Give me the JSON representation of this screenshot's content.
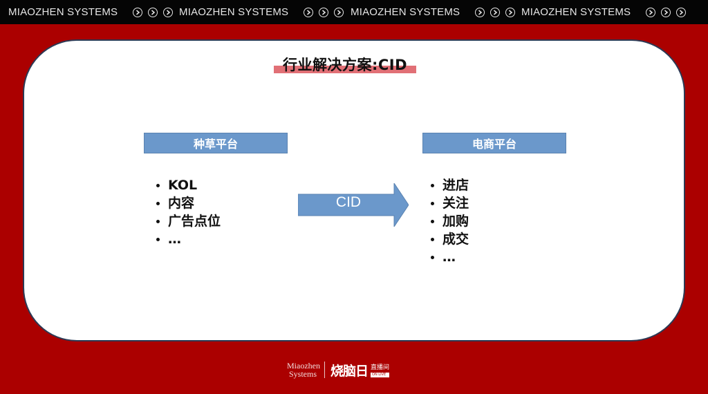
{
  "topbar": {
    "brand_text": "MIAOZHEN SYSTEMS",
    "repeats": 4,
    "icon": "play-circle-icon"
  },
  "slide": {
    "title": "行业解决方案:CID",
    "left_box": {
      "label": "种草平台"
    },
    "left_items": [
      "KOL",
      "内容",
      "广告点位",
      "…"
    ],
    "arrow_label": "CID",
    "right_box": {
      "label": "电商平台"
    },
    "right_items": [
      "进店",
      "关注",
      "加购",
      "成交",
      "…"
    ]
  },
  "footer": {
    "brand_line1": "Miaozhen",
    "brand_line2": "Systems",
    "logo_text": "烧脑日",
    "logo_sub_top": "直播间",
    "logo_sub_bottom": "ON LIVE"
  },
  "colors": {
    "background": "#ab0000",
    "topbar": "#050505",
    "box": "#6b98cb",
    "title_highlight": "#e17076"
  }
}
